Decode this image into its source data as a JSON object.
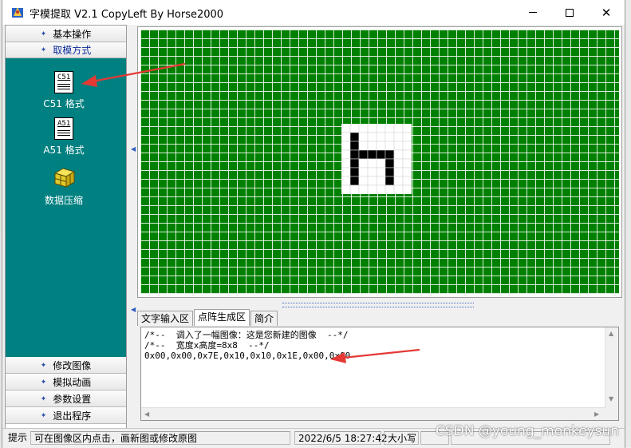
{
  "window": {
    "title": "字模提取 V2.1  CopyLeft By Horse2000",
    "controls": {
      "minimize": "—",
      "maximize": "☐",
      "close": "✕"
    }
  },
  "sidebar": {
    "top_items": [
      {
        "label": "基本操作",
        "icon": "diamond-bullet-icon"
      },
      {
        "label": "取模方式",
        "icon": "diamond-bullet-icon"
      }
    ],
    "tools": [
      {
        "label": "C51 格式",
        "icon_text": "C51",
        "icon": "c51-document-icon"
      },
      {
        "label": "A51 格式",
        "icon_text": "A51",
        "icon": "a51-document-icon"
      },
      {
        "label": "数据压缩",
        "icon": "compress-box-icon"
      }
    ],
    "bottom_items": [
      {
        "label": "修改图像",
        "icon": "diamond-bullet-icon"
      },
      {
        "label": "模拟动画",
        "icon": "diamond-bullet-icon"
      },
      {
        "label": "参数设置",
        "icon": "diamond-bullet-icon"
      },
      {
        "label": "退出程序",
        "icon": "diamond-bullet-icon"
      }
    ]
  },
  "canvas": {
    "grid_color": "#008000",
    "glyph_bitmap": [
      "00000000",
      "01000000",
      "01000000",
      "01111100",
      "01000100",
      "01000100",
      "01000100",
      "00000000"
    ]
  },
  "tabs": [
    {
      "label": "文字输入区",
      "active": false
    },
    {
      "label": "点阵生成区",
      "active": true
    },
    {
      "label": "简介",
      "active": false
    }
  ],
  "output": {
    "line1": "/*--  调入了一幅图像：这是您新建的图像  --*/",
    "line2": "/*--  宽度x高度=8x8  --*/",
    "line3": "0x00,0x00,0x7E,0x10,0x10,0x1E,0x00,0x00"
  },
  "statusbar": {
    "label": "提示",
    "hint": "可在图像区内点击，画新图或修改原图",
    "datetime": "2022/6/5 18:27:42",
    "caps": "大小写"
  },
  "watermark": "CSDN @young_monkeysun",
  "colors": {
    "teal": "#008080",
    "annotation_arrow": "#e53935",
    "grid": "#008000"
  }
}
